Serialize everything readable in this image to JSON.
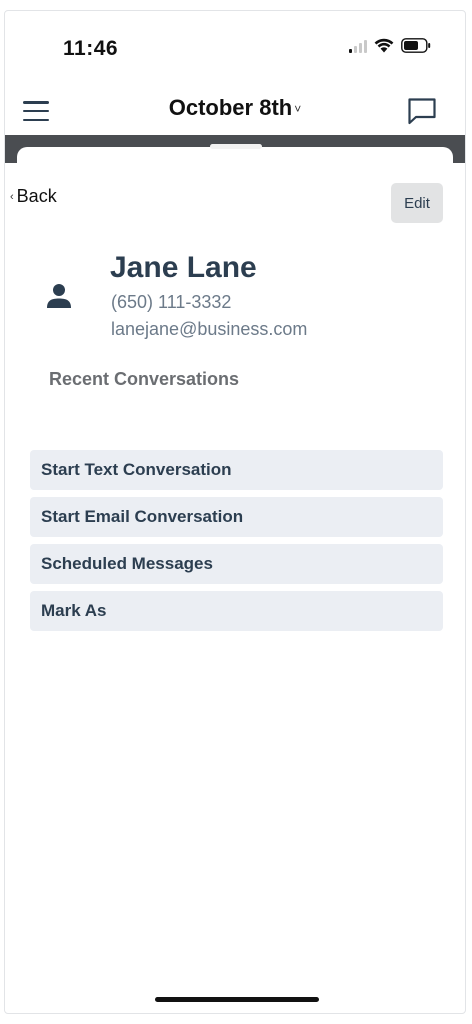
{
  "status_bar": {
    "time": "11:46",
    "icons": [
      "cellular-signal-icon",
      "wifi-icon",
      "battery-icon"
    ]
  },
  "header": {
    "title": "October 8th",
    "title_caret": "˅",
    "left_icon": "hamburger-menu-icon",
    "right_icon": "chat-bubble-icon"
  },
  "nav": {
    "back_label": "Back",
    "back_chevron": "‹",
    "edit_label": "Edit"
  },
  "contact": {
    "avatar_icon": "person-icon",
    "name": "Jane Lane",
    "phone": "(650) 111-3332",
    "email": "lanejane@business.com"
  },
  "recent": {
    "title": "Recent Conversations"
  },
  "actions": [
    {
      "label": "Start Text Conversation"
    },
    {
      "label": "Start Email Conversation"
    },
    {
      "label": "Scheduled Messages"
    },
    {
      "label": "Mark As"
    }
  ],
  "colors": {
    "primary_text": "#2c3e50",
    "secondary_text": "#6c7a89",
    "action_background": "#ebeef3",
    "edit_background": "#e2e3e4",
    "dark_band": "#4a4d51"
  }
}
